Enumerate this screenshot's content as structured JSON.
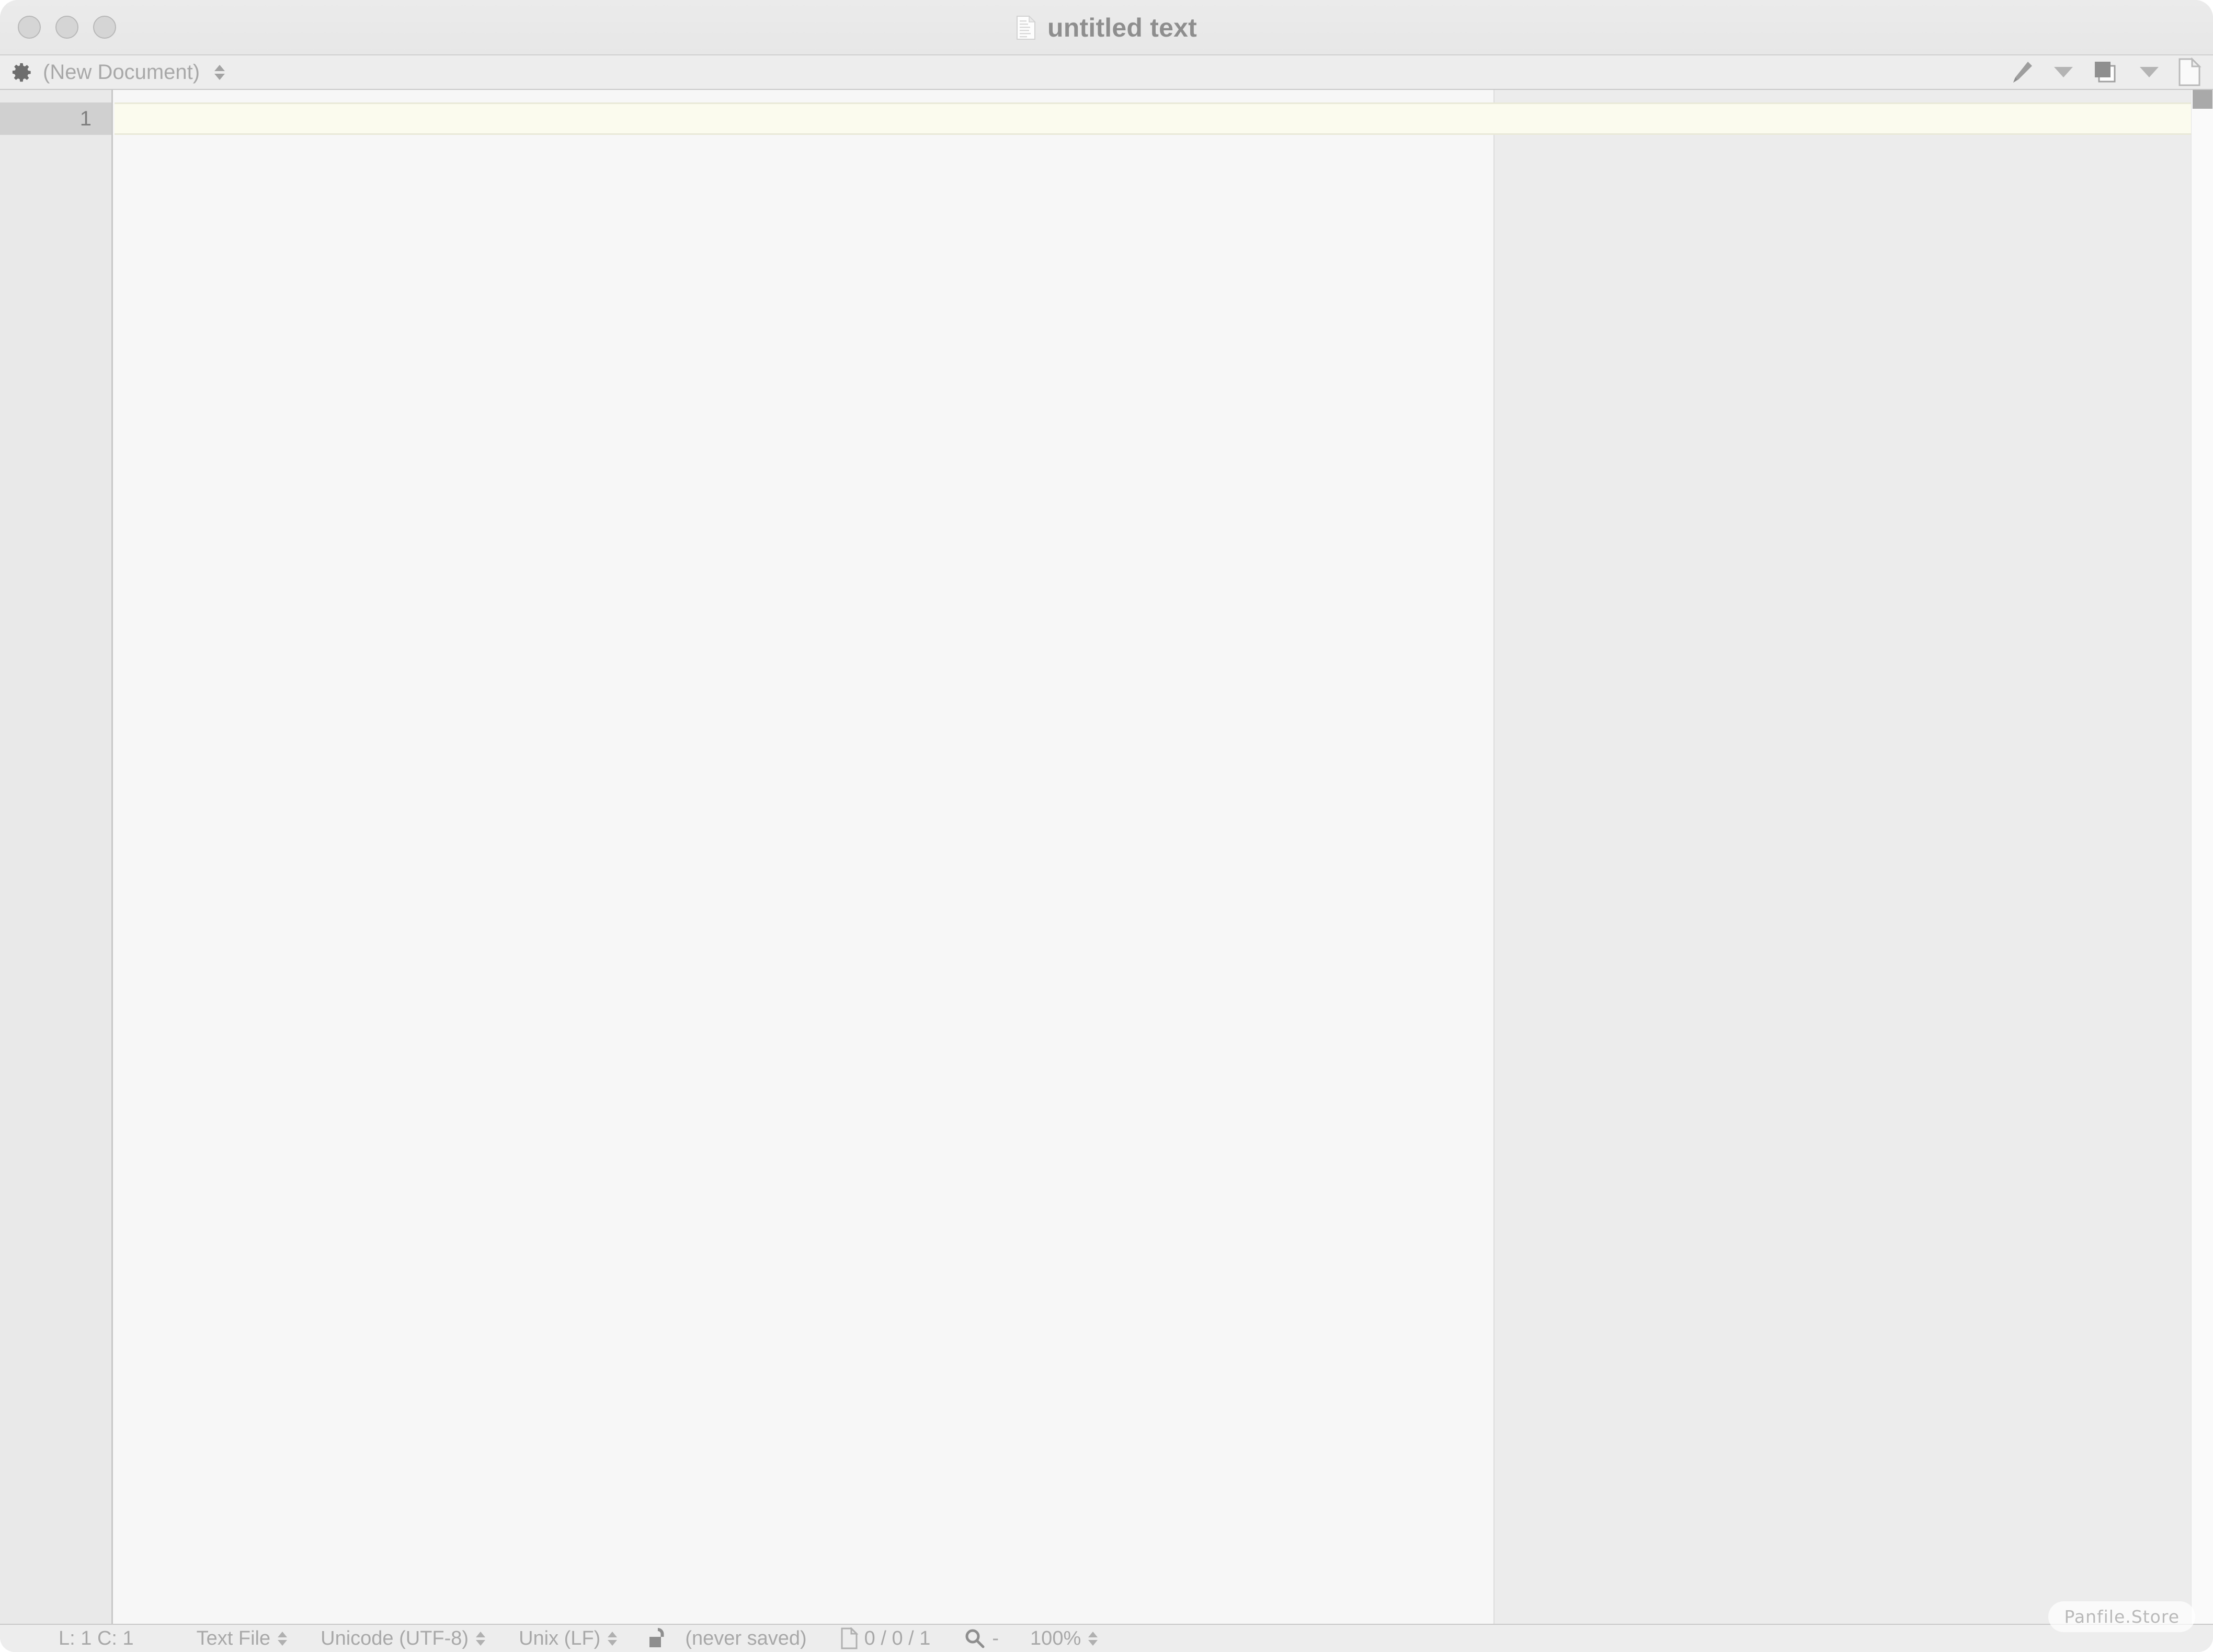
{
  "window": {
    "title": "untitled text",
    "title_icon": "document-icon",
    "traffic_lights": [
      "close-button",
      "minimize-button",
      "zoom-button"
    ]
  },
  "toolbar": {
    "settings_icon": "gear-icon",
    "document_selector_value": "(New Document)",
    "right_buttons": [
      {
        "icon": "pen-icon",
        "name": "pen-tool-button"
      },
      {
        "icon": "chevron-down-icon",
        "name": "pen-options-chevron"
      },
      {
        "icon": "layers-icon",
        "name": "documents-button"
      },
      {
        "icon": "chevron-down-icon",
        "name": "documents-options-chevron"
      },
      {
        "icon": "new-document-icon",
        "name": "new-document-button"
      }
    ]
  },
  "editor": {
    "line_numbers": [
      "1"
    ],
    "content": "",
    "current_line": 1,
    "page_guide_column": true,
    "colors": {
      "page_background": "#f7f7f7",
      "overflow_background": "#ececec",
      "current_line_highlight": "#fbfbee",
      "gutter_background": "#e9e9e9",
      "gutter_active": "#d0d0d0"
    }
  },
  "statusbar": {
    "cursor_position": "L: 1 C: 1",
    "file_type": "Text File",
    "encoding": "Unicode (UTF-8)",
    "line_endings": "Unix (LF)",
    "lock_icon": "unlocked-padlock-icon",
    "save_state": "(never saved)",
    "stats_icon": "document-icon",
    "stats": "0 / 0 / 1",
    "search_icon": "magnifier-icon",
    "search_value": "-",
    "zoom_level": "100%"
  },
  "watermark": {
    "text": "Panfile.Store"
  }
}
